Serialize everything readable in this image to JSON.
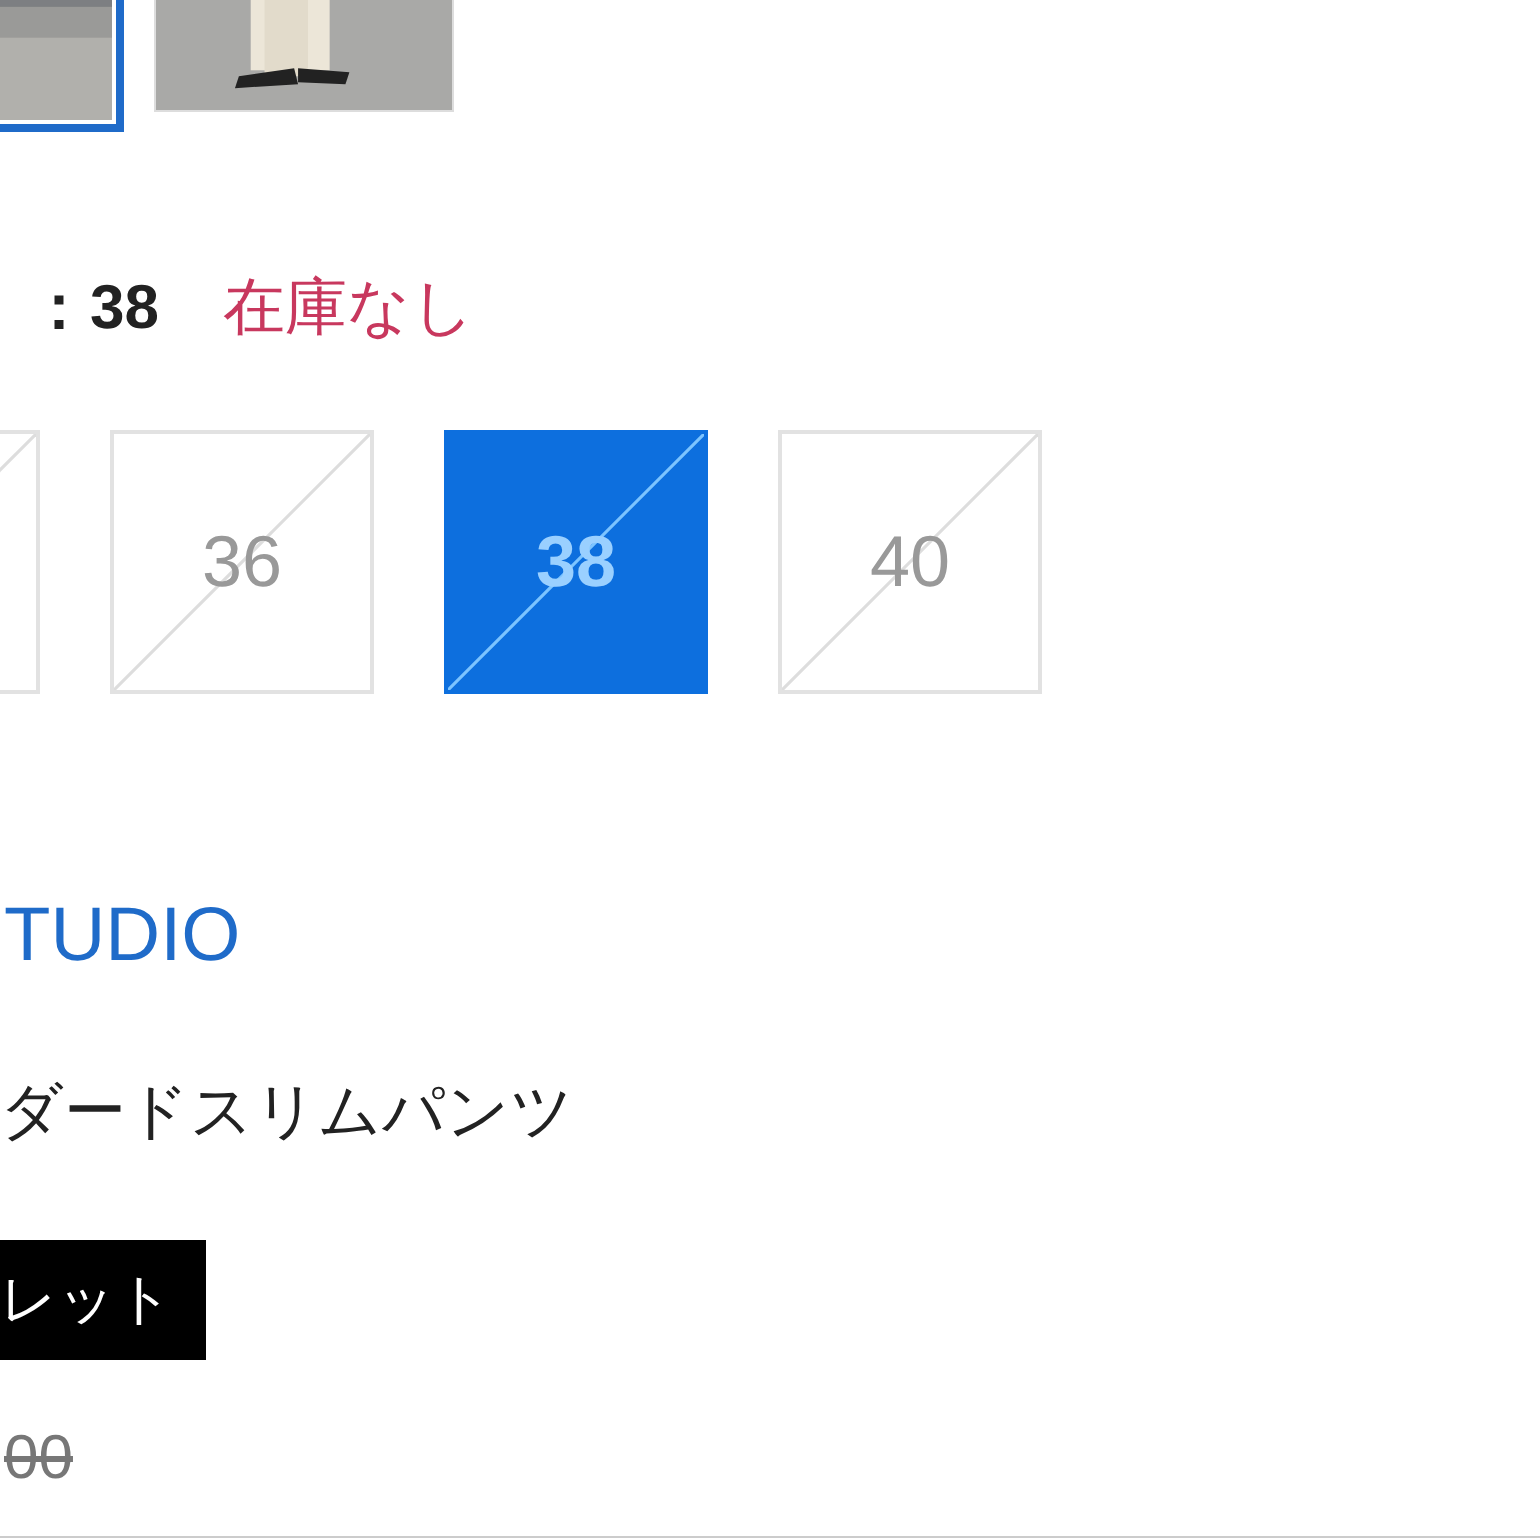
{
  "thumbnails": [
    {
      "kind": "picture",
      "selected": true
    },
    {
      "kind": "picture",
      "selected": false
    }
  ],
  "size_label": {
    "value": "：38",
    "stock": "在庫なし"
  },
  "sizes": [
    {
      "selected": false,
      "sold_out": true
    },
    {
      "label": "36",
      "selected": false,
      "sold_out": true
    },
    {
      "label": "38",
      "selected": true,
      "sold_out": true
    },
    {
      "label": "40",
      "selected": false,
      "sold_out": true
    }
  ],
  "brand": "TUDIO",
  "product_name": "ダードスリムパンツ",
  "badge": "レット",
  "price": "00"
}
